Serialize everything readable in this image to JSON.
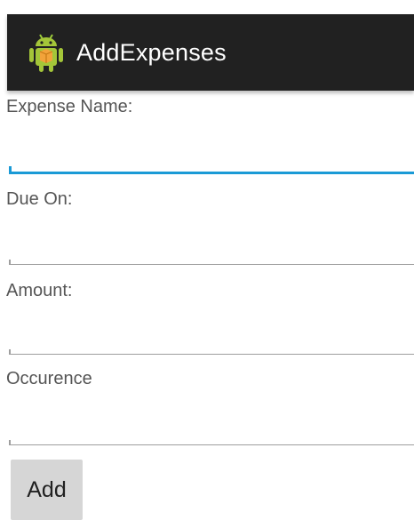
{
  "action_bar": {
    "title": "AddExpenses",
    "icon": "android-app-icon",
    "background": "#212121"
  },
  "form": {
    "fields": [
      {
        "label": "Expense Name:",
        "value": "",
        "focused": true
      },
      {
        "label": "Due On:",
        "value": "",
        "focused": false
      },
      {
        "label": "Amount:",
        "value": "",
        "focused": false
      },
      {
        "label": "Occurence",
        "value": "",
        "focused": false
      }
    ],
    "add_label": "Add"
  },
  "colors": {
    "accent": "#1a9ad6",
    "label": "#555555",
    "button": "#d6d6d6"
  }
}
